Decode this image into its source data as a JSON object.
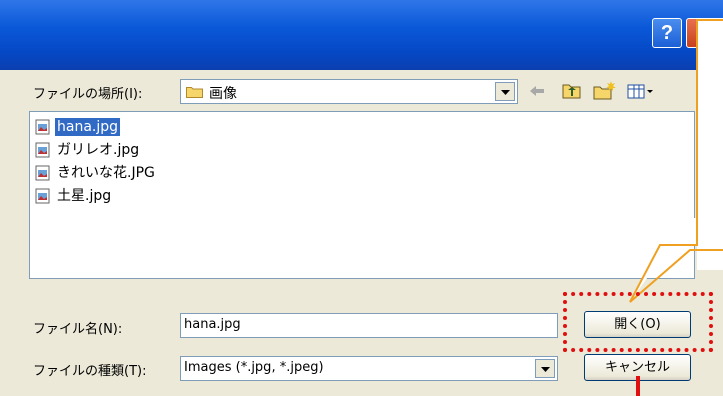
{
  "dialog": {
    "title": "",
    "help_symbol": "?",
    "close_symbol": "×"
  },
  "lookin": {
    "label": "ファイルの場所(I):",
    "value": "画像"
  },
  "toolbar": {
    "icons": [
      "back-arrow-icon",
      "up-folder-icon",
      "new-folder-icon",
      "view-menu-icon"
    ]
  },
  "files": [
    {
      "name": "hana.jpg",
      "selected": true
    },
    {
      "name": "ガリレオ.jpg",
      "selected": false
    },
    {
      "name": "きれいな花.JPG",
      "selected": false
    },
    {
      "name": "土星.jpg",
      "selected": false
    }
  ],
  "filename": {
    "label": "ファイル名(N):",
    "value": "hana.jpg"
  },
  "filetype": {
    "label": "ファイルの種類(T):",
    "value": "Images (*.jpg, *.jpeg)"
  },
  "buttons": {
    "open": "開く(O)",
    "cancel": "キャンセル"
  },
  "colors": {
    "titlebar": "#0a58d8",
    "selection": "#316ac5",
    "highlight": "#e01010",
    "callout_border": "#f0a020"
  }
}
